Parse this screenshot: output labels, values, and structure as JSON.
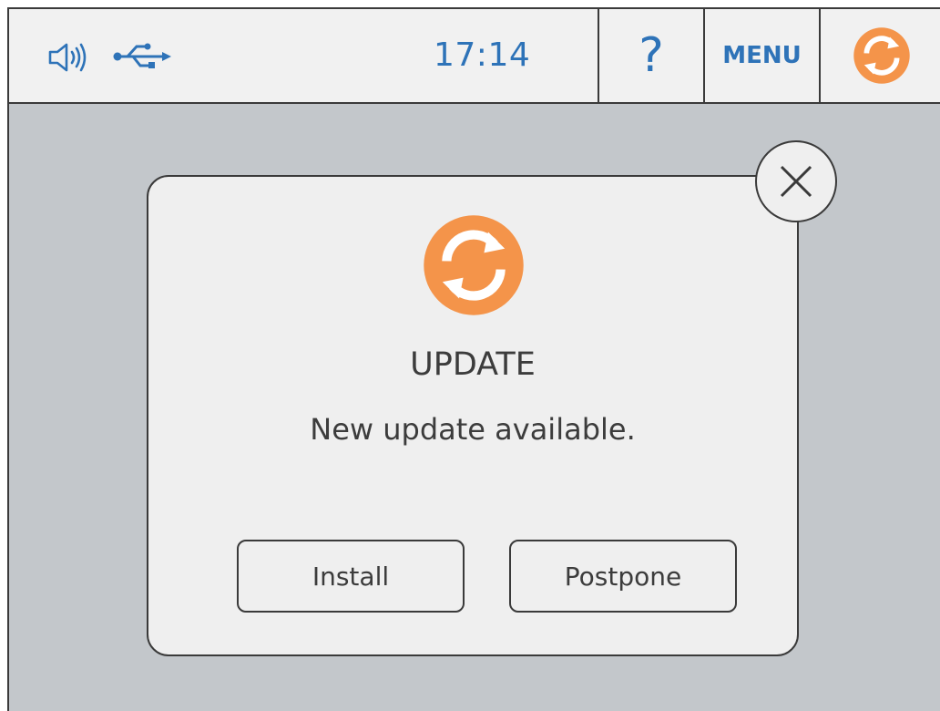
{
  "statusbar": {
    "time": "17:14",
    "help_label": "?",
    "menu_label": "MENU",
    "icons": [
      "speaker-icon",
      "usb-icon",
      "sync-icon"
    ]
  },
  "dialog": {
    "title": "UPDATE",
    "message": "New update available.",
    "install_label": "Install",
    "postpone_label": "Postpone",
    "icon": "sync-icon",
    "close_icon": "close-icon"
  },
  "colors": {
    "accent_blue": "#2e73b8",
    "sync_orange": "#f4944a",
    "background": "#c3c7cb",
    "panel": "#efefef"
  }
}
